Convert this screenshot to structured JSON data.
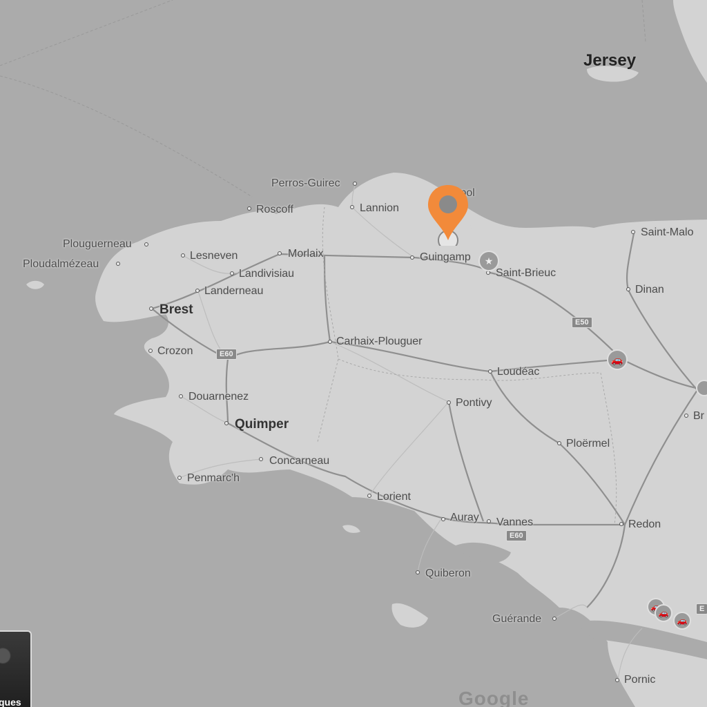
{
  "map": {
    "island_label": "Jersey",
    "cities": [
      {
        "name": "Perros-Guirec",
        "type": "minor"
      },
      {
        "name": "Lannion",
        "type": "minor"
      },
      {
        "name": "Paimpol",
        "type": "minor"
      },
      {
        "name": "Roscoff",
        "type": "minor"
      },
      {
        "name": "Plouguerneau",
        "type": "minor"
      },
      {
        "name": "Lesneven",
        "type": "minor"
      },
      {
        "name": "Morlaix",
        "type": "minor"
      },
      {
        "name": "Ploudalmézeau",
        "type": "minor"
      },
      {
        "name": "Landivisiau",
        "type": "minor"
      },
      {
        "name": "Landerneau",
        "type": "minor"
      },
      {
        "name": "Brest",
        "type": "major"
      },
      {
        "name": "Guingamp",
        "type": "minor"
      },
      {
        "name": "Saint-Brieuc",
        "type": "minor"
      },
      {
        "name": "Saint-Malo",
        "type": "minor"
      },
      {
        "name": "Dinan",
        "type": "minor"
      },
      {
        "name": "Carhaix-Plouguer",
        "type": "minor"
      },
      {
        "name": "Crozon",
        "type": "minor"
      },
      {
        "name": "Loudéac",
        "type": "minor"
      },
      {
        "name": "Douarnenez",
        "type": "minor"
      },
      {
        "name": "Pontivy",
        "type": "minor"
      },
      {
        "name": "Quimper",
        "type": "major"
      },
      {
        "name": "Ploërmel",
        "type": "minor"
      },
      {
        "name": "Concarneau",
        "type": "minor"
      },
      {
        "name": "Penmarc'h",
        "type": "minor"
      },
      {
        "name": "Lorient",
        "type": "minor"
      },
      {
        "name": "Auray",
        "type": "minor"
      },
      {
        "name": "Vannes",
        "type": "minor"
      },
      {
        "name": "Redon",
        "type": "minor"
      },
      {
        "name": "Quiberon",
        "type": "minor"
      },
      {
        "name": "Guérande",
        "type": "minor"
      },
      {
        "name": "Pornic",
        "type": "minor"
      },
      {
        "name": "Br",
        "type": "minor"
      }
    ],
    "road_shields": [
      "E50",
      "E60",
      "E60",
      "E"
    ],
    "marker_color": "#f28a3a",
    "land_color": "#d3d3d3",
    "water_color": "#ababab",
    "layer_toggle_label": "ques",
    "logo_text": "Google"
  }
}
